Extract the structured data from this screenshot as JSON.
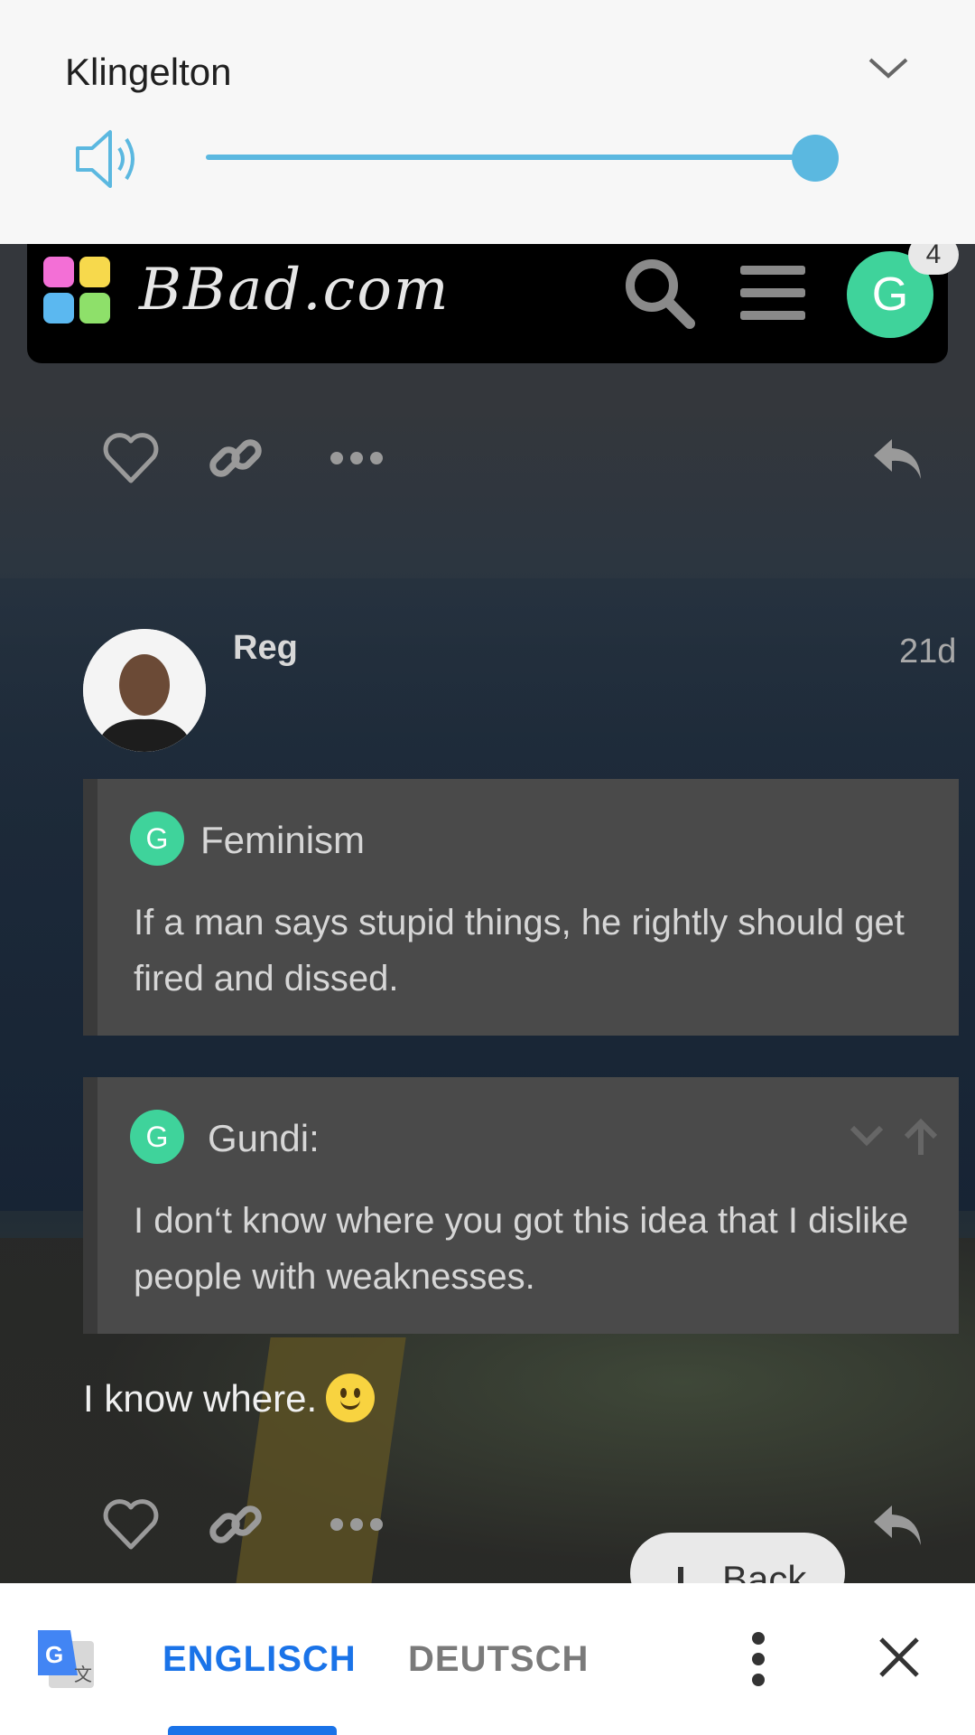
{
  "volume_panel": {
    "title": "Klingelton",
    "level": 1.0,
    "accent": "#5bb8e0",
    "icons": [
      "chevron-down-icon",
      "speaker-icon"
    ]
  },
  "site_header": {
    "site_name": "BBad.com",
    "avatar_letter": "G",
    "notification_count": "4",
    "icons": [
      "logo-mark",
      "search-icon",
      "hamburger-menu-icon"
    ],
    "avatar_color": "#3fd39b"
  },
  "post": {
    "author": "Reg",
    "time": "21d",
    "quotes": [
      {
        "avatar_letter": "G",
        "title": "Feminism",
        "text": "If a man says stupid things, he rightly should get fired and dissed."
      },
      {
        "avatar_letter": "G",
        "title": "Gundi:",
        "text": "I don‘t know where you got this idea that I dislike people with weaknesses."
      }
    ],
    "reply_text": "I know where.",
    "action_icons": [
      "heart-icon",
      "link-icon",
      "more-icon",
      "reply-icon"
    ]
  },
  "back_button": {
    "label": "Back"
  },
  "translate_bar": {
    "source_lang": "ENGLISCH",
    "target_lang": "DEUTSCH",
    "active_color": "#1a73e8",
    "icons": [
      "google-translate-icon",
      "more-vert-icon",
      "close-icon"
    ]
  }
}
